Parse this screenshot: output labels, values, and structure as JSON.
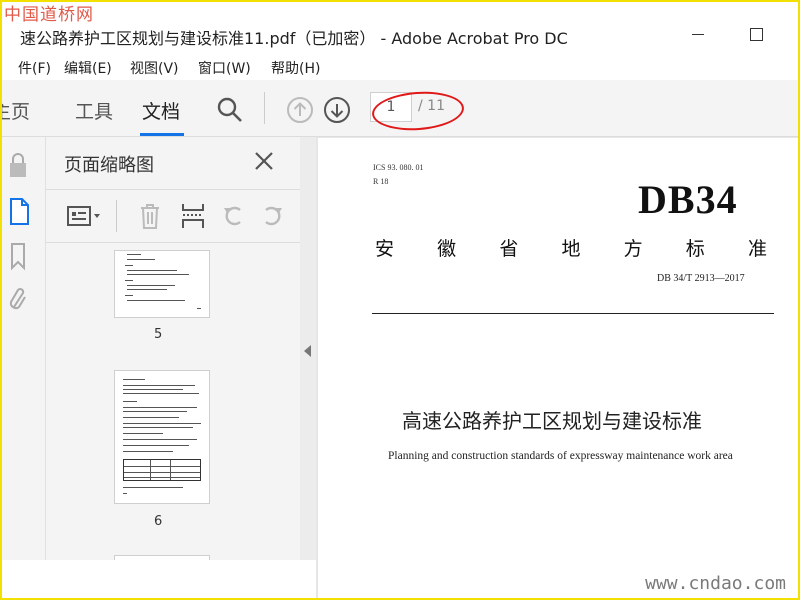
{
  "watermarks": {
    "top": "中国道桥网",
    "bottom": "www.cndao.com"
  },
  "window": {
    "title": "速公路养护工区规划与建设标准11.pdf（已加密） - Adobe Acrobat Pro DC"
  },
  "menu": {
    "items": [
      "件(F)",
      "编辑(E)",
      "视图(V)",
      "窗口(W)",
      "帮助(H)"
    ]
  },
  "toolbar": {
    "tabs": [
      "主页",
      "工具",
      "文档"
    ],
    "active_tab": "文档",
    "page_current": "1",
    "page_total": "/ 11",
    "accent": "#1473e6",
    "annotation_color": "#e01818"
  },
  "sidebar_icons": [
    "lock-icon",
    "page-icon",
    "bookmark-icon",
    "paperclip-icon"
  ],
  "thumbnails_panel": {
    "title": "页面缩略图",
    "tools": [
      "options-icon",
      "trash-icon",
      "insert-page-icon",
      "rotate-ccw-icon",
      "rotate-cw-icon"
    ],
    "pages": [
      "5",
      "6"
    ]
  },
  "document": {
    "ics": "ICS 93. 080. 01",
    "r": "R 18",
    "code": "DB34",
    "province": [
      "安",
      "徽",
      "省",
      "地",
      "方",
      "标",
      "准"
    ],
    "standard_no": "DB 34/T  2913—2017",
    "title_cn": "高速公路养护工区规划与建设标准",
    "title_en": "Planning and construction standards of expressway maintenance work area"
  }
}
